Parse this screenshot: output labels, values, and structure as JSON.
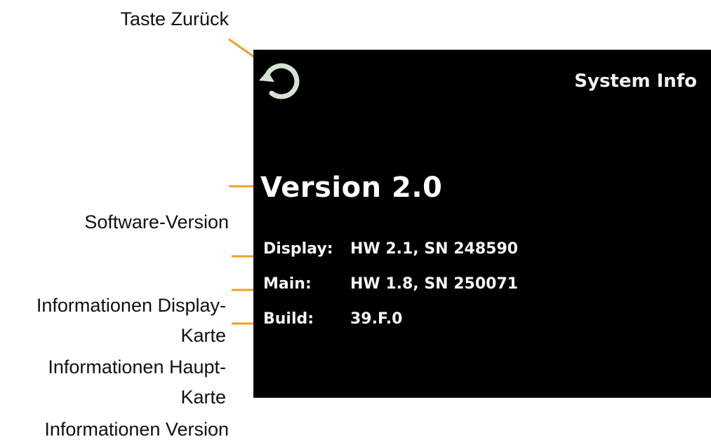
{
  "callouts": {
    "back_button": "Taste Zurück",
    "software_version": "Software-Version",
    "display_card_line1": "Informationen Display-",
    "display_card_line2": "Karte",
    "main_card_line1": "Informationen Haupt-",
    "main_card_line2": "Karte",
    "build_info": "Informationen Version"
  },
  "screen": {
    "title": "System Info",
    "version": "Version 2.0",
    "rows": [
      {
        "key": "Display:",
        "value": "HW 2.1, SN 248590"
      },
      {
        "key": "Main:",
        "value": "HW 1.8, SN 250071"
      },
      {
        "key": "Build:",
        "value": "39.F.0"
      }
    ]
  },
  "icons": {
    "back": "refresh-arrow-icon"
  },
  "colors": {
    "leader_line": "#f0a020",
    "screen_background": "#000000",
    "icon_fill": "#d7e3d2",
    "text": "#ffffff"
  }
}
